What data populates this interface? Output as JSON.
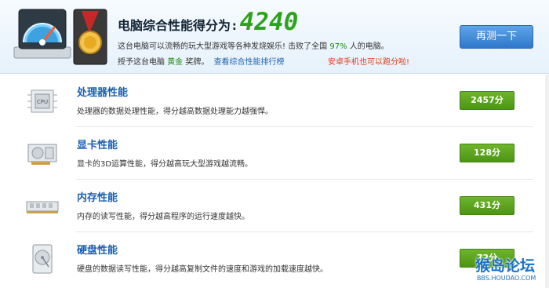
{
  "header": {
    "score_label": "电脑综合性能得分为:",
    "score_value": "4240",
    "line1_before": "这台电脑可以流畅的玩大型游戏等各种发烧娱乐! 击败了全国",
    "line1_pct": "97%",
    "line1_after": "人的电脑。",
    "line2_before": "授予这台电脑",
    "line2_badge": "黄金",
    "line2_mid": "奖牌。",
    "rank_link": "查看综合性能排行榜",
    "promo": "安卓手机也可以跑分啦!",
    "retest_label": "再测一下"
  },
  "items": [
    {
      "icon": "cpu-icon",
      "name": "处理器性能",
      "desc": "处理器的数据处理性能，得分越高数据处理能力越强悍。",
      "score": "2457分"
    },
    {
      "icon": "graphics-card-icon",
      "name": "显卡性能",
      "desc": "显卡的3D运算性能，得分越高玩大型游戏越流畅。",
      "score": "128分"
    },
    {
      "icon": "memory-icon",
      "name": "内存性能",
      "desc": "内存的读写性能，得分越高程序的运行速度越快。",
      "score": "431分"
    },
    {
      "icon": "hard-disk-icon",
      "name": "硬盘性能",
      "desc": "硬盘的数据读写性能，得分越高复制文件的速度和游戏的加载速度越快。",
      "score": "72分"
    }
  ],
  "watermark": {
    "main": "猴岛论坛",
    "sub": "BBS.HOUDAO.COM"
  }
}
